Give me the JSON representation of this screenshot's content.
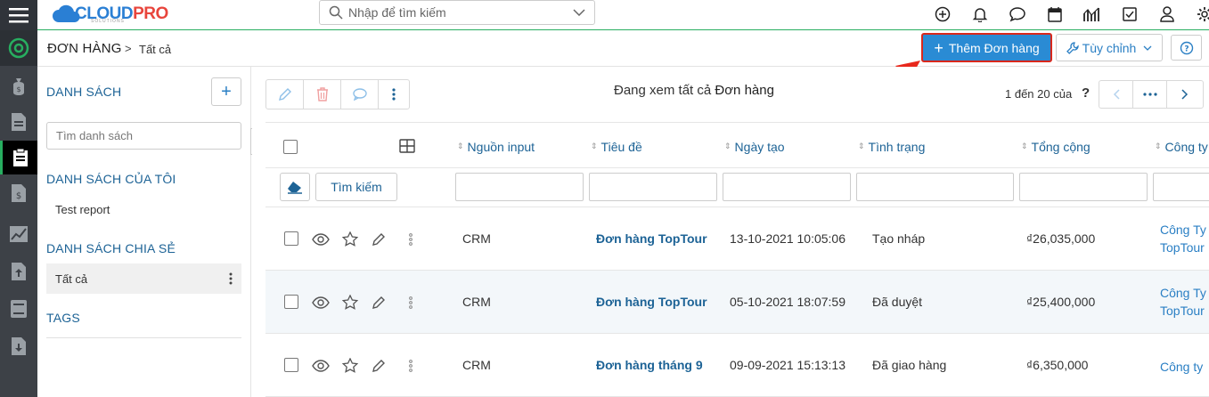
{
  "app": {
    "logo": {
      "cloud": "CLOUD",
      "pro": "PRO",
      "tagline": "SOLUTIONS"
    },
    "search_placeholder": "Nhập để tìm kiếm"
  },
  "rail": {
    "items": [
      "home",
      "money-bag",
      "document",
      "order",
      "quote",
      "chart",
      "upload",
      "book",
      "download"
    ]
  },
  "toolbar_icons": [
    "plus-circle-icon",
    "bell-icon",
    "chat-icon",
    "calendar-icon",
    "analytics-icon",
    "checkbox-icon",
    "user-icon",
    "gear-icon"
  ],
  "header": {
    "module": "ĐƠN HÀNG",
    "separator": ">",
    "view": "Tất cả",
    "add_label": "Thêm Đơn hàng",
    "customize_label": "Tùy chỉnh"
  },
  "sidebar": {
    "title": "DANH SÁCH",
    "search_placeholder": "Tìm danh sách",
    "my_lists_title": "DANH SÁCH CỦA TÔI",
    "my_lists": [
      "Test report"
    ],
    "shared_title": "DANH SÁCH CHIA SẺ",
    "shared": [
      "Tất cả"
    ],
    "tags_title": "TAGS"
  },
  "main": {
    "viewing_prefix": "Đang xem tất cả",
    "viewing_module": "Đơn hàng",
    "pager_text": "1 đến 20 của",
    "pager_q": "?",
    "columns": [
      "Nguồn input",
      "Tiêu đề",
      "Ngày tạo",
      "Tình trạng",
      "Tổng cộng",
      "Công ty"
    ],
    "search_button": "Tìm kiếm",
    "rows": [
      {
        "source": "CRM",
        "title": "Đơn hàng TopTour",
        "created": "13-10-2021 10:05:06",
        "status": "Tạo nháp",
        "total": "₫26,035,000",
        "company1": "Công Ty",
        "company2": "TopTour"
      },
      {
        "source": "CRM",
        "title": "Đơn hàng TopTour",
        "created": "05-10-2021 18:07:59",
        "status": "Đã duyệt",
        "total": "₫25,400,000",
        "company1": "Công Ty",
        "company2": "TopTour"
      },
      {
        "source": "CRM",
        "title": "Đơn hàng tháng 9",
        "created": "09-09-2021 15:13:13",
        "status": "Đã giao hàng",
        "total": "₫6,350,000",
        "company1": "Công ty",
        "company2": ""
      }
    ]
  },
  "colors": {
    "accent": "#2a8bd4",
    "highlight": "#d9281c",
    "rail": "#3d4147",
    "success": "#27ae60",
    "link": "#1d6396"
  }
}
